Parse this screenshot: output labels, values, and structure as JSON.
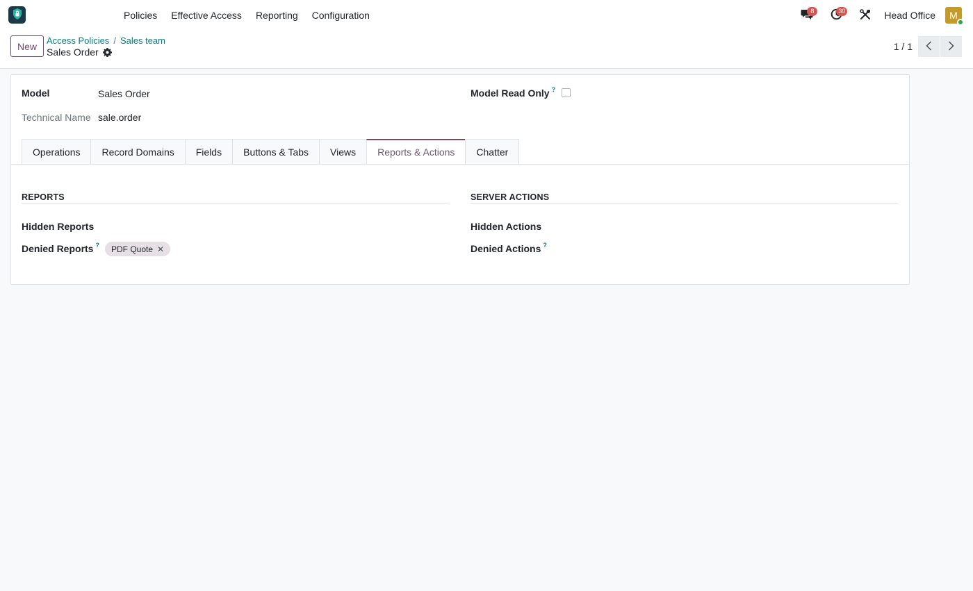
{
  "nav": {
    "menu": [
      "Policies",
      "Effective Access",
      "Reporting",
      "Configuration"
    ],
    "messages_count": "8",
    "activities_count": "30",
    "company": "Head Office",
    "avatar_initial": "M",
    "colors": {
      "accent": "#714b67",
      "link": "#017e84",
      "badge": "#d9534f",
      "avatar": "#c49a2a",
      "logo_bg": "#1b3a49"
    }
  },
  "control": {
    "new_label": "New",
    "breadcrumb": [
      "Access Policies",
      "Sales team"
    ],
    "record_title": "Sales Order",
    "pager": "1 / 1"
  },
  "form": {
    "model_label": "Model",
    "model_value": "Sales Order",
    "technical_label": "Technical Name",
    "technical_value": "sale.order",
    "readonly_label": "Model Read Only",
    "help_mark": "?",
    "tabs": [
      "Operations",
      "Record Domains",
      "Fields",
      "Buttons & Tabs",
      "Views",
      "Reports & Actions",
      "Chatter"
    ],
    "active_tab": "Reports & Actions",
    "reports": {
      "title": "REPORTS",
      "hidden_label": "Hidden Reports",
      "denied_label": "Denied Reports",
      "denied_tags": [
        "PDF Quote"
      ]
    },
    "actions": {
      "title": "SERVER ACTIONS",
      "hidden_label": "Hidden Actions",
      "denied_label": "Denied Actions"
    }
  }
}
